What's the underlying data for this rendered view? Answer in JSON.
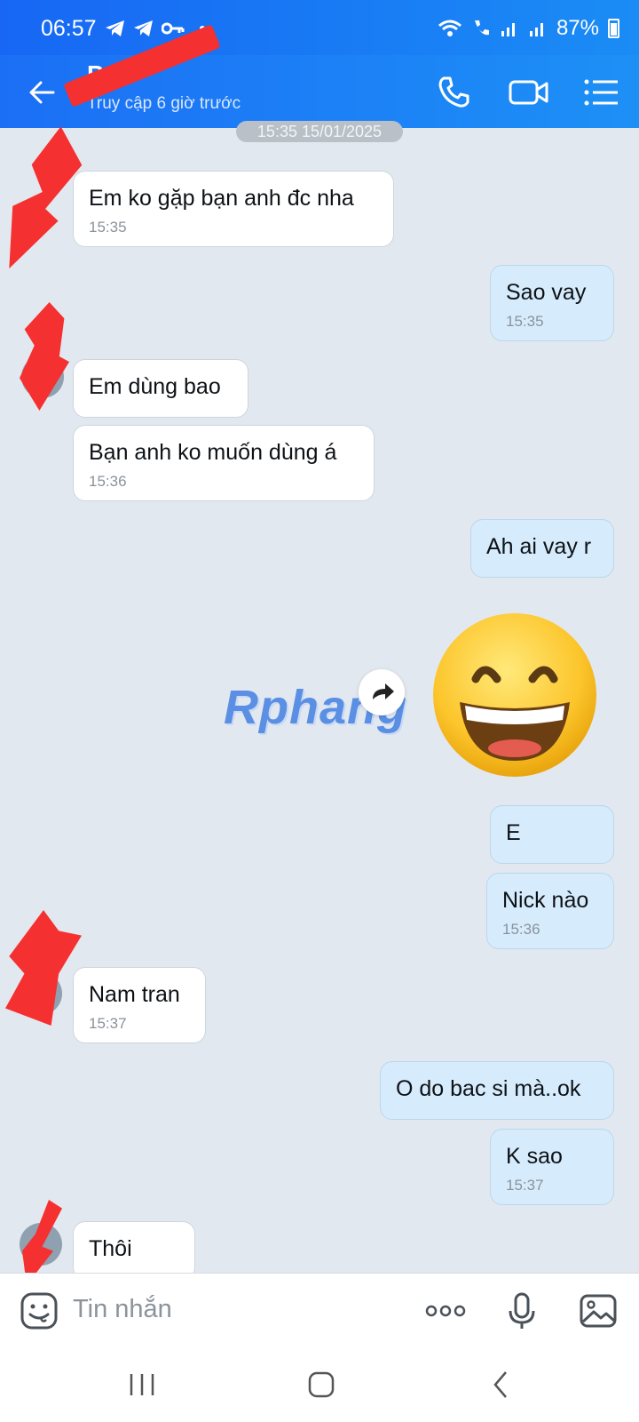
{
  "status": {
    "time": "06:57",
    "battery": "87%"
  },
  "header": {
    "contact_name": "P",
    "last_seen": "Truy cập 6 giờ trước"
  },
  "chat": {
    "date_chip": "15:35 15/01/2025",
    "messages": [
      {
        "dir": "in",
        "text": "Em ko gặp bạn anh đc nha",
        "time": "15:35"
      },
      {
        "dir": "out",
        "text": "Sao vay",
        "time": "15:35"
      },
      {
        "dir": "in",
        "text": "Em dùng bao",
        "time": ""
      },
      {
        "dir": "in",
        "text": "Bạn anh ko muốn dùng á",
        "time": "15:36"
      },
      {
        "dir": "out",
        "text": "Ah ai vay r",
        "time": ""
      },
      {
        "dir": "out",
        "text": "E",
        "time": ""
      },
      {
        "dir": "out",
        "text": "Nick nào",
        "time": "15:36"
      },
      {
        "dir": "in",
        "text": "Nam tran",
        "time": "15:37"
      },
      {
        "dir": "out",
        "text": "O do bac si mà..ok",
        "time": ""
      },
      {
        "dir": "out",
        "text": "K sao",
        "time": "15:37"
      },
      {
        "dir": "in",
        "text": "Thôi",
        "time": ""
      }
    ],
    "sticker": "grinning-face-sticker",
    "watermark": "Rphang"
  },
  "input": {
    "placeholder": "Tin nhắn"
  },
  "colors": {
    "header_start": "#1b6ff5",
    "header_end": "#1d90f6",
    "bubble_out": "#d6ecfd",
    "bubble_in": "#ffffff",
    "background": "#e2e8ef"
  }
}
